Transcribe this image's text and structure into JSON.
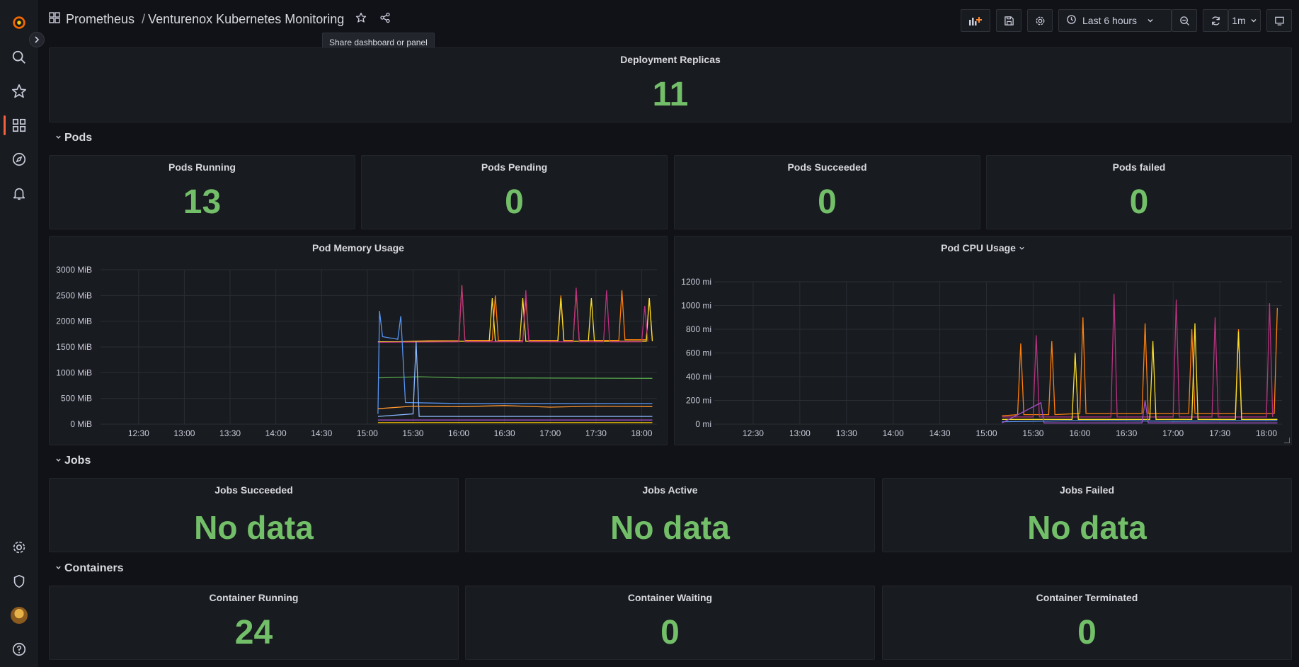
{
  "header": {
    "folder": "Prometheus",
    "separator": "/",
    "dashboard_title": "Venturenox Kubernetes Monitoring",
    "tooltip": "Share dashboard or panel",
    "time_range": "Last 6 hours",
    "refresh_interval": "1m"
  },
  "panels": {
    "deployment_replicas": {
      "title": "Deployment Replicas",
      "value": "11"
    },
    "pods_row": "Pods",
    "pods_running": {
      "title": "Pods Running",
      "value": "13"
    },
    "pods_pending": {
      "title": "Pods Pending",
      "value": "0"
    },
    "pods_succeeded": {
      "title": "Pods Succeeded",
      "value": "0"
    },
    "pods_failed": {
      "title": "Pods failed",
      "value": "0"
    },
    "jobs_row": "Jobs",
    "jobs_succeeded": {
      "title": "Jobs Succeeded",
      "value": "No data"
    },
    "jobs_active": {
      "title": "Jobs Active",
      "value": "No data"
    },
    "jobs_failed": {
      "title": "Jobs Failed",
      "value": "No data"
    },
    "containers_row": "Containers",
    "container_running": {
      "title": "Container Running",
      "value": "24"
    },
    "container_waiting": {
      "title": "Container Waiting",
      "value": "0"
    },
    "container_terminated": {
      "title": "Container Terminated",
      "value": "0"
    }
  },
  "chart_data": [
    {
      "type": "line",
      "title": "Pod Memory Usage",
      "y_ticks": [
        "0 MiB",
        "500 MiB",
        "1000 MiB",
        "1500 MiB",
        "2000 MiB",
        "2500 MiB",
        "3000 MiB"
      ],
      "ylim": [
        0,
        3000
      ],
      "x_ticks": [
        "12:30",
        "13:00",
        "13:30",
        "14:00",
        "14:30",
        "15:00",
        "15:30",
        "16:00",
        "16:30",
        "17:00",
        "17:30",
        "18:00"
      ],
      "grid": true,
      "series": [
        {
          "color": "#ff7f0e",
          "points": [
            [
              "15:07",
              1600
            ],
            [
              "15:20",
              1600
            ],
            [
              "15:40",
              1620
            ],
            [
              "16:00",
              1620
            ],
            [
              "16:02",
              2700
            ],
            [
              "16:04",
              1630
            ],
            [
              "16:22",
              1630
            ],
            [
              "16:24",
              2500
            ],
            [
              "16:26",
              1630
            ],
            [
              "16:42",
              1630
            ],
            [
              "16:44",
              2450
            ],
            [
              "16:46",
              1630
            ],
            [
              "17:05",
              1630
            ],
            [
              "17:07",
              2500
            ],
            [
              "17:09",
              1630
            ],
            [
              "17:15",
              1630
            ],
            [
              "17:17",
              2600
            ],
            [
              "17:19",
              1630
            ],
            [
              "17:45",
              1630
            ],
            [
              "17:47",
              2600
            ],
            [
              "17:49",
              1640
            ],
            [
              "18:03",
              1640
            ],
            [
              "18:05",
              2450
            ],
            [
              "18:07",
              1640
            ]
          ]
        },
        {
          "color": "#fade2a",
          "points": [
            [
              "15:07",
              1600
            ],
            [
              "15:22",
              1600
            ],
            [
              "15:40",
              1610
            ],
            [
              "16:20",
              1610
            ],
            [
              "16:22",
              2450
            ],
            [
              "16:24",
              1610
            ],
            [
              "16:40",
              1610
            ],
            [
              "16:42",
              2450
            ],
            [
              "16:44",
              1610
            ],
            [
              "17:05",
              1610
            ],
            [
              "17:07",
              2450
            ],
            [
              "17:09",
              1610
            ],
            [
              "17:25",
              1610
            ],
            [
              "17:27",
              2450
            ],
            [
              "17:29",
              1610
            ],
            [
              "18:03",
              1610
            ],
            [
              "18:05",
              2450
            ],
            [
              "18:07",
              1610
            ]
          ]
        },
        {
          "color": "#b83280",
          "points": [
            [
              "15:07",
              1590
            ],
            [
              "16:00",
              1600
            ],
            [
              "16:02",
              2700
            ],
            [
              "16:04",
              1600
            ],
            [
              "16:42",
              1600
            ],
            [
              "16:44",
              2600
            ],
            [
              "16:46",
              1600
            ],
            [
              "17:15",
              1600
            ],
            [
              "17:17",
              2650
            ],
            [
              "17:19",
              1600
            ],
            [
              "17:35",
              1600
            ],
            [
              "17:37",
              2600
            ],
            [
              "17:39",
              1600
            ],
            [
              "18:00",
              1600
            ],
            [
              "18:02",
              2300
            ],
            [
              "18:04",
              1600
            ]
          ]
        },
        {
          "color": "#56a64b",
          "points": [
            [
              "15:07",
              900
            ],
            [
              "15:35",
              920
            ],
            [
              "16:00",
              900
            ],
            [
              "18:07",
              890
            ]
          ]
        },
        {
          "color": "#5794f2",
          "points": [
            [
              "15:07",
              200
            ],
            [
              "15:08",
              2200
            ],
            [
              "15:10",
              1700
            ],
            [
              "15:20",
              1650
            ],
            [
              "15:22",
              2100
            ],
            [
              "15:25",
              420
            ],
            [
              "16:00",
              400
            ],
            [
              "18:07",
              400
            ]
          ]
        },
        {
          "color": "#8ab8ff",
          "points": [
            [
              "15:07",
              150
            ],
            [
              "15:30",
              200
            ],
            [
              "15:32",
              1600
            ],
            [
              "15:34",
              150
            ],
            [
              "18:07",
              150
            ]
          ]
        },
        {
          "color": "#ff9830",
          "points": [
            [
              "15:07",
              300
            ],
            [
              "15:30",
              350
            ],
            [
              "16:00",
              340
            ],
            [
              "16:30",
              360
            ],
            [
              "17:00",
              330
            ],
            [
              "17:30",
              350
            ],
            [
              "18:07",
              340
            ]
          ]
        },
        {
          "color": "#a352cc",
          "points": [
            [
              "15:07",
              80
            ],
            [
              "18:07",
              80
            ]
          ]
        },
        {
          "color": "#e0b400",
          "points": [
            [
              "15:07",
              30
            ],
            [
              "18:07",
              30
            ]
          ]
        }
      ]
    },
    {
      "type": "line",
      "title": "Pod CPU Usage",
      "y_ticks": [
        "0 mi",
        "200 mi",
        "400 mi",
        "600 mi",
        "800 mi",
        "1000 mi",
        "1200 mi"
      ],
      "ylim": [
        0,
        1200
      ],
      "x_ticks": [
        "12:30",
        "13:00",
        "13:30",
        "14:00",
        "14:30",
        "15:00",
        "15:30",
        "16:00",
        "16:30",
        "17:00",
        "17:30",
        "18:00"
      ],
      "grid": true,
      "series": [
        {
          "color": "#ff7f0e",
          "points": [
            [
              "15:10",
              70
            ],
            [
              "15:20",
              80
            ],
            [
              "15:22",
              680
            ],
            [
              "15:24",
              80
            ],
            [
              "15:40",
              80
            ],
            [
              "15:42",
              700
            ],
            [
              "15:44",
              80
            ],
            [
              "16:00",
              90
            ],
            [
              "16:02",
              900
            ],
            [
              "16:04",
              90
            ],
            [
              "16:40",
              90
            ],
            [
              "16:42",
              850
            ],
            [
              "16:44",
              90
            ],
            [
              "17:10",
              90
            ],
            [
              "17:12",
              800
            ],
            [
              "17:14",
              90
            ],
            [
              "17:40",
              90
            ],
            [
              "17:42",
              800
            ],
            [
              "17:44",
              90
            ],
            [
              "18:05",
              90
            ],
            [
              "18:07",
              980
            ]
          ]
        },
        {
          "color": "#b83280",
          "points": [
            [
              "15:10",
              60
            ],
            [
              "15:30",
              60
            ],
            [
              "15:32",
              750
            ],
            [
              "15:34",
              60
            ],
            [
              "16:20",
              60
            ],
            [
              "16:22",
              1100
            ],
            [
              "16:24",
              60
            ],
            [
              "17:00",
              60
            ],
            [
              "17:02",
              1050
            ],
            [
              "17:04",
              60
            ],
            [
              "17:25",
              60
            ],
            [
              "17:27",
              900
            ],
            [
              "17:29",
              60
            ],
            [
              "18:00",
              60
            ],
            [
              "18:02",
              1020
            ],
            [
              "18:04",
              60
            ]
          ]
        },
        {
          "color": "#fade2a",
          "points": [
            [
              "15:10",
              40
            ],
            [
              "15:55",
              40
            ],
            [
              "15:57",
              600
            ],
            [
              "15:59",
              40
            ],
            [
              "16:45",
              40
            ],
            [
              "16:47",
              700
            ],
            [
              "16:49",
              40
            ],
            [
              "17:12",
              40
            ],
            [
              "17:14",
              850
            ],
            [
              "17:16",
              40
            ],
            [
              "17:40",
              40
            ],
            [
              "17:42",
              780
            ],
            [
              "17:44",
              40
            ],
            [
              "18:07",
              40
            ]
          ]
        },
        {
          "color": "#5794f2",
          "points": [
            [
              "15:10",
              20
            ],
            [
              "16:00",
              30
            ],
            [
              "17:00",
              25
            ],
            [
              "18:07",
              30
            ]
          ]
        },
        {
          "color": "#a352cc",
          "points": [
            [
              "15:10",
              10
            ],
            [
              "15:35",
              180
            ],
            [
              "15:37",
              10
            ],
            [
              "16:40",
              10
            ],
            [
              "16:42",
              200
            ],
            [
              "16:44",
              10
            ],
            [
              "18:07",
              10
            ]
          ]
        }
      ]
    }
  ]
}
